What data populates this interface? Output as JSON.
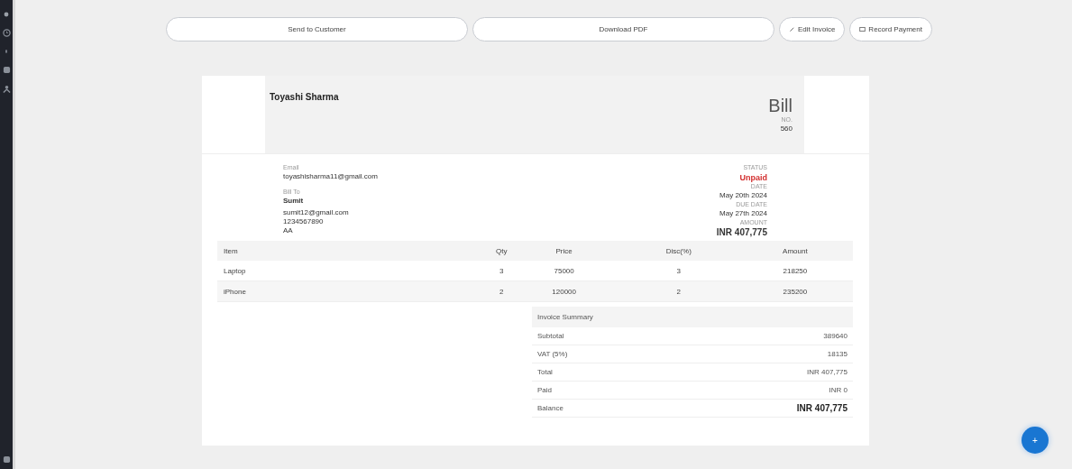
{
  "sidebar": {
    "items": [
      {
        "kind": "dot"
      },
      {
        "kind": "clock"
      },
      {
        "kind": "line"
      },
      {
        "kind": "square"
      },
      {
        "kind": "person"
      }
    ],
    "bottom": {
      "kind": "square"
    }
  },
  "actions": [
    {
      "label": "Send to Customer",
      "kind": "wide"
    },
    {
      "label": "Download PDF",
      "kind": "wide"
    },
    {
      "label": "Edit Invoice",
      "kind": "edit"
    },
    {
      "label": "Record Payment",
      "kind": "payment"
    }
  ],
  "invoice": {
    "company": "Toyashi Sharma",
    "title": "Bill",
    "number_label": "NO.",
    "number": "560",
    "email_label": "Email",
    "email": "toyashisharma11@gmail.com",
    "bill_to_label": "Bill To",
    "bill_to_name": "Sumit",
    "bill_to_lines": [
      "sumit12@gmail.com",
      "1234567890",
      "AA"
    ],
    "meta": [
      {
        "label": "STATUS",
        "value": "Unpaid",
        "kind": "status"
      },
      {
        "label": "DATE",
        "value": "May 20th 2024",
        "kind": "plain"
      },
      {
        "label": "DUE DATE",
        "value": "May 27th 2024",
        "kind": "plain"
      },
      {
        "label": "AMOUNT",
        "value": "INR 407,775",
        "kind": "amount"
      }
    ],
    "table": {
      "columns": [
        "Item",
        "Qty",
        "Price",
        "Disc(%)",
        "Amount"
      ],
      "rows": [
        [
          "Laptop",
          "3",
          "75000",
          "3",
          "218250"
        ],
        [
          "iPhone",
          "2",
          "120000",
          "2",
          "235200"
        ]
      ]
    },
    "summary": {
      "title": "Invoice Summary",
      "rows": [
        {
          "label": "Subtotal",
          "value": "389640",
          "kind": "plain"
        },
        {
          "label": "VAT (5%)",
          "value": "18135",
          "kind": "plain"
        },
        {
          "label": "Total",
          "value": "INR 407,775",
          "kind": "plain"
        },
        {
          "label": "Paid",
          "value": "INR 0",
          "kind": "plain"
        },
        {
          "label": "Balance",
          "value": "INR 407,775",
          "kind": "balance"
        }
      ]
    }
  },
  "fab": {
    "label": "+"
  }
}
